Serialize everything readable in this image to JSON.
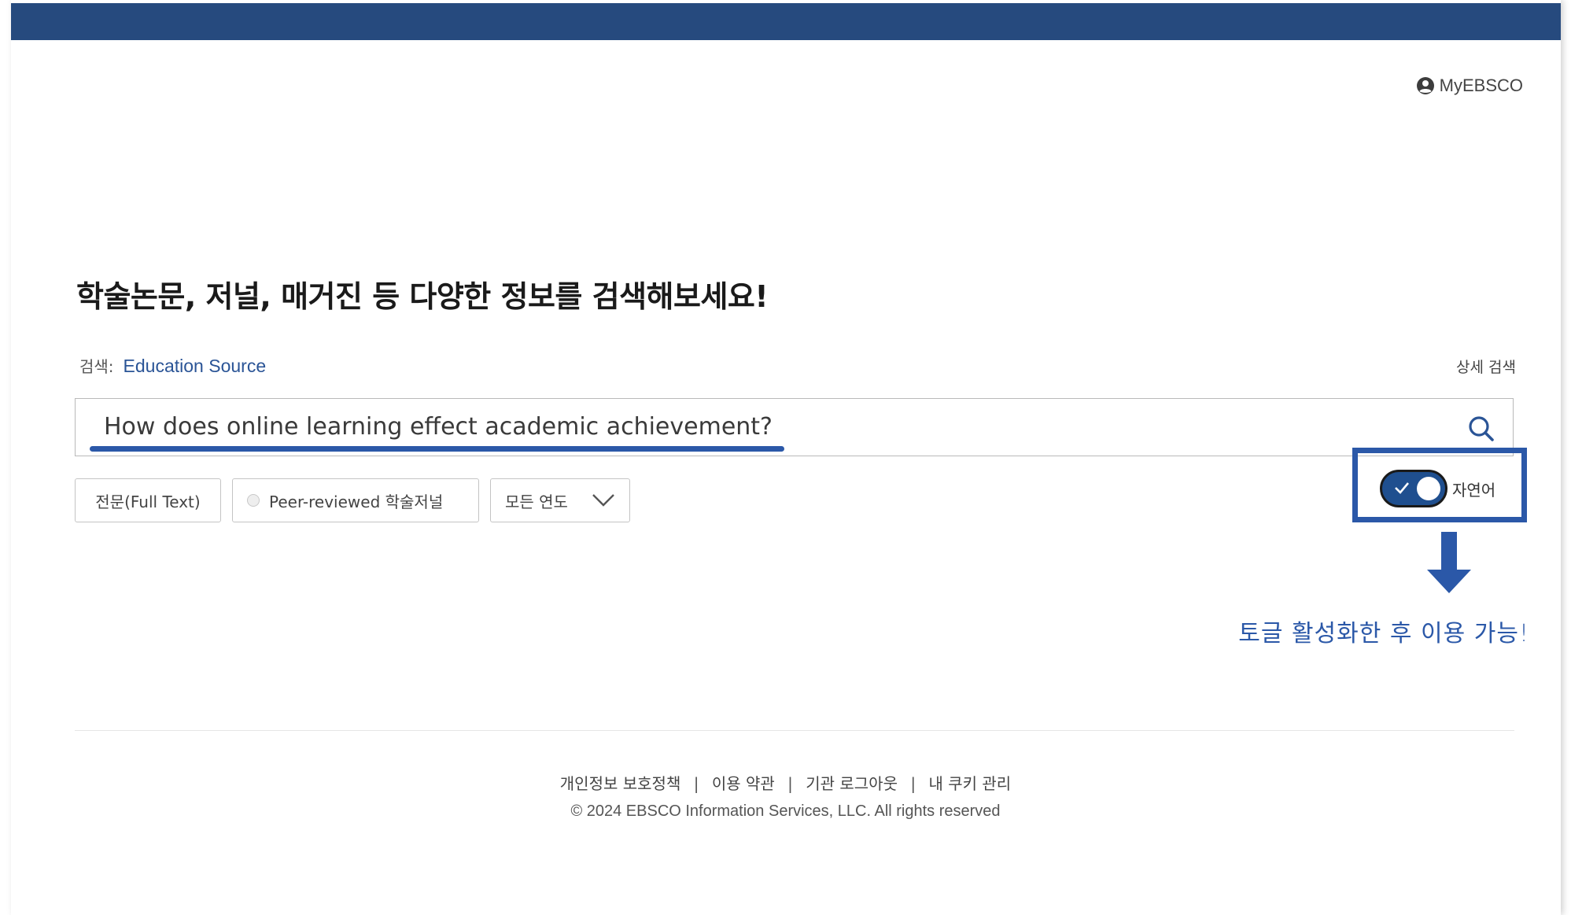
{
  "colors": {
    "top_bar": "#264a7e",
    "accent_blue": "#2a5496",
    "annotation_blue": "#2b58a8",
    "toggle_fill": "#1f4f8f"
  },
  "header": {
    "account_icon": "user-circle-icon",
    "account_label": "MyEBSCO"
  },
  "main": {
    "headline": "학술논문, 저널, 매거진 등 다양한 정보를 검색해보세요!",
    "search_scope_label": "검색:",
    "search_scope_db": "Education Source",
    "advanced_search": "상세 검색",
    "search": {
      "value": "How does online learning effect academic achievement?",
      "icon": "search-icon"
    },
    "filters": {
      "full_text": "전문(Full Text)",
      "peer_reviewed": "Peer-reviewed 학술저널",
      "years": "모든 연도"
    },
    "toggle": {
      "label": "자연어",
      "enabled": true
    },
    "annotation": "토글 활성화한 후 이용 가능!"
  },
  "footer": {
    "links": [
      "개인정보 보호정책",
      "이용 약관",
      "기관 로그아웃",
      "내 쿠키 관리"
    ],
    "separator": "|",
    "copyright": "© 2024 EBSCO Information Services, LLC. All rights reserved"
  }
}
